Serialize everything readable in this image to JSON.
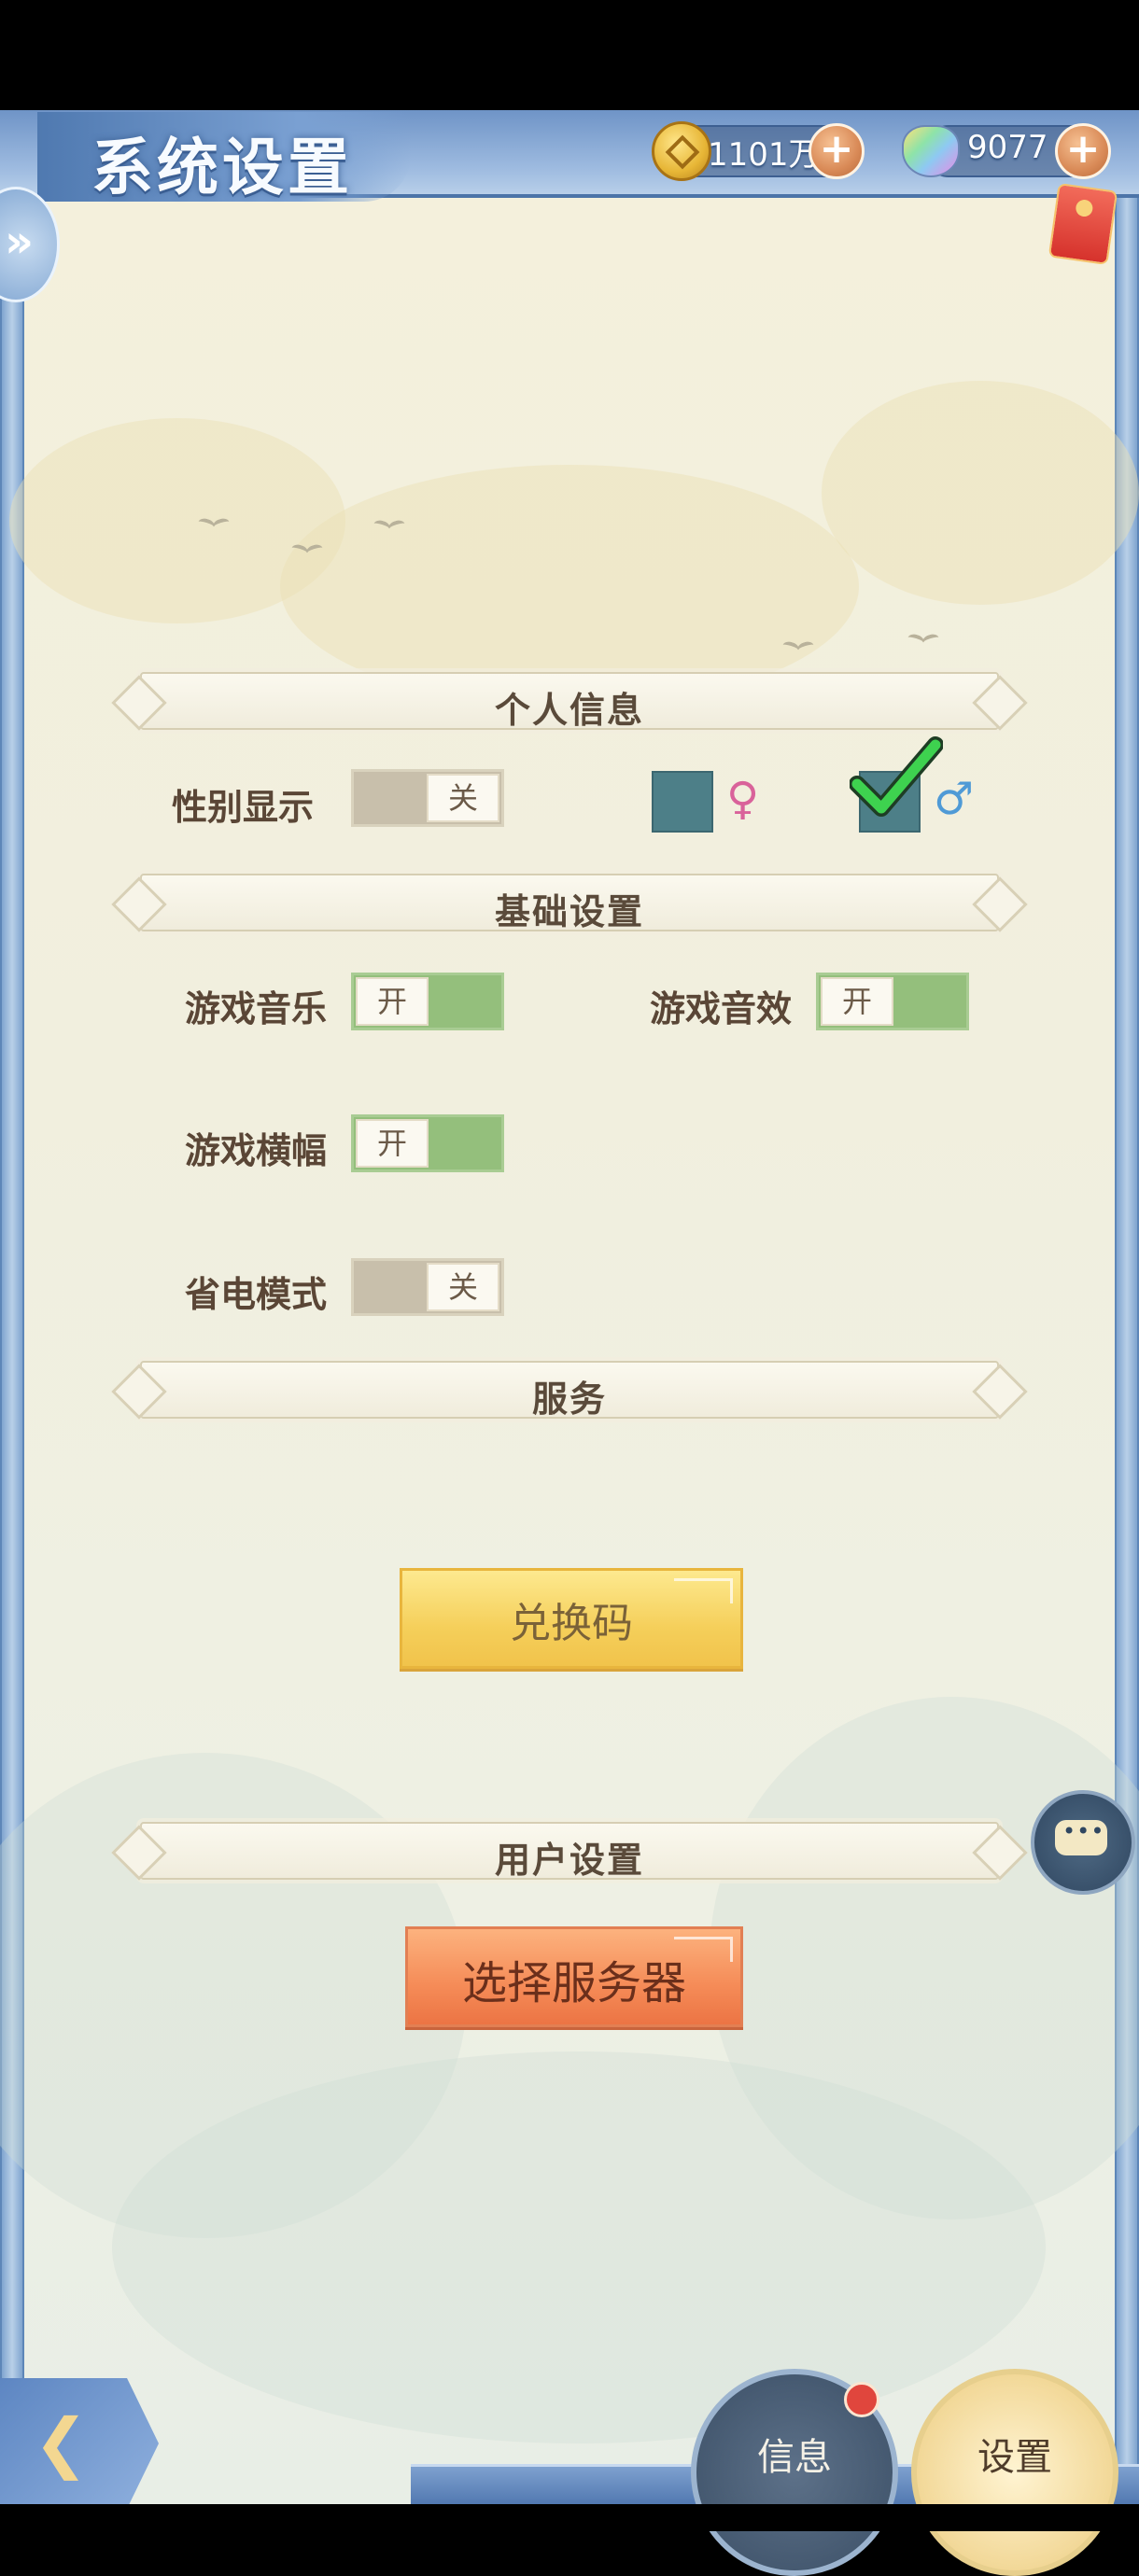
{
  "header": {
    "title": "系统设置",
    "coins": "1101万",
    "gems": "9077"
  },
  "sections": {
    "personal": "个人信息",
    "basic": "基础设置",
    "service": "服务",
    "user": "用户设置"
  },
  "settings": {
    "gender_display": {
      "label": "性别显示",
      "state": "关",
      "on": false
    },
    "gender_female_symbol": "♀",
    "gender_male_symbol": "♂",
    "gender_selected": "male",
    "music": {
      "label": "游戏音乐",
      "state": "开",
      "on": true
    },
    "sound": {
      "label": "游戏音效",
      "state": "开",
      "on": true
    },
    "banner": {
      "label": "游戏横幅",
      "state": "开",
      "on": true
    },
    "power_saving": {
      "label": "省电模式",
      "state": "关",
      "on": false
    }
  },
  "buttons": {
    "redeem": "兑换码",
    "select_server": "选择服务器"
  },
  "bottom_nav": {
    "info": "信息",
    "settings": "设置"
  },
  "colors": {
    "toggle_on": "#94bf7c",
    "toggle_off": "#c8bfab",
    "female": "#d9629a",
    "male": "#4f9ad6",
    "check": "#3ed24f"
  }
}
